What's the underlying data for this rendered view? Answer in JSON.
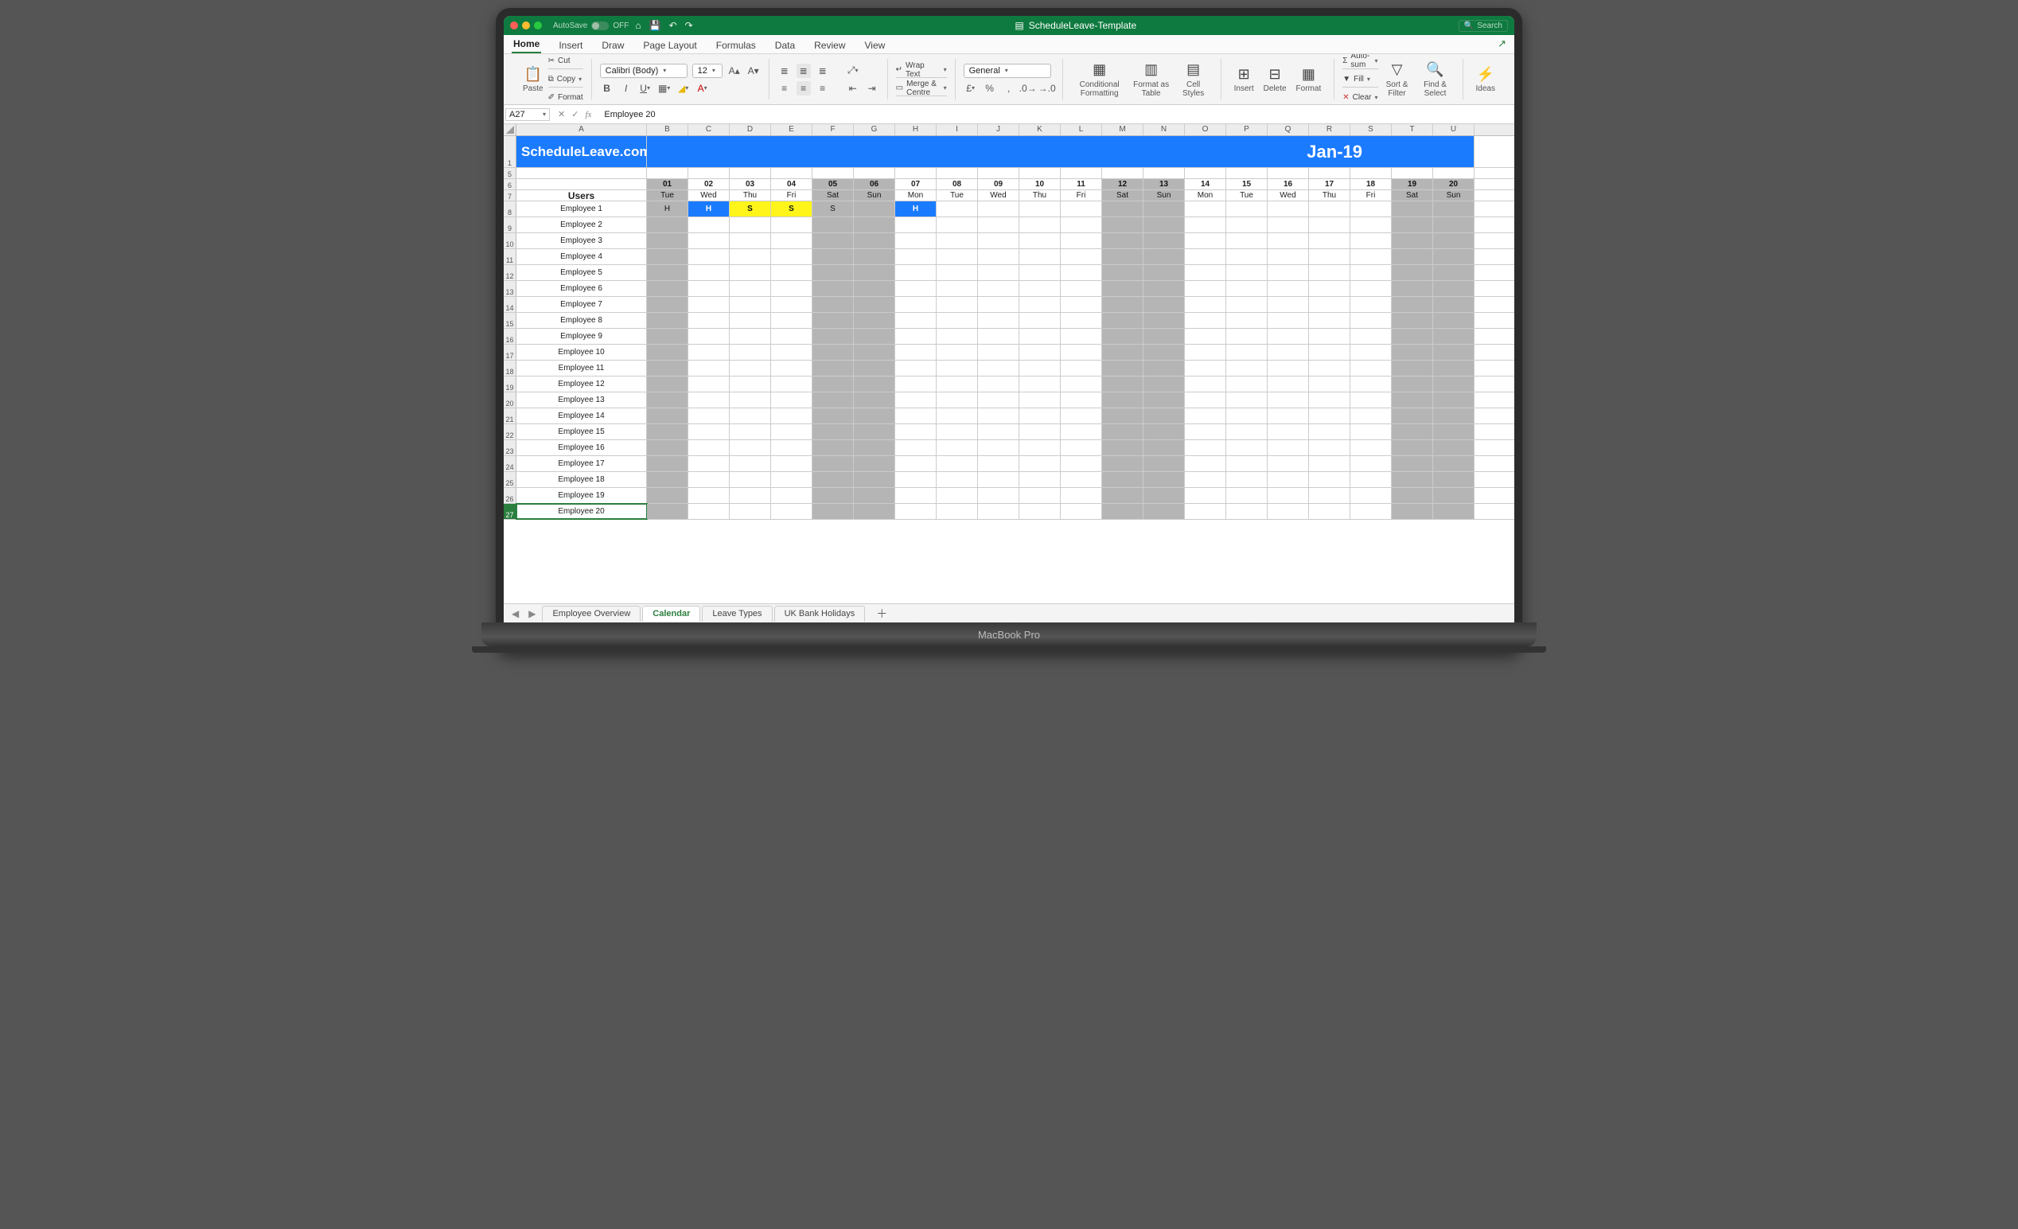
{
  "title": "ScheduleLeave-Template",
  "autosave_label": "AutoSave",
  "autosave_state": "OFF",
  "search_placeholder": "Search",
  "laptop_brand": "MacBook Pro",
  "ribbon_tabs": [
    "Home",
    "Insert",
    "Draw",
    "Page Layout",
    "Formulas",
    "Data",
    "Review",
    "View"
  ],
  "ribbon": {
    "paste": "Paste",
    "cut": "Cut",
    "copy": "Copy",
    "format": "Format",
    "font_name": "Calibri (Body)",
    "font_size": "12",
    "wrap": "Wrap Text",
    "merge": "Merge & Centre",
    "number_format": "General",
    "cond": "Conditional Formatting",
    "fat": "Format as Table",
    "cstyles": "Cell Styles",
    "insert": "Insert",
    "delete": "Delete",
    "rformat": "Format",
    "autosum": "Auto-sum",
    "fill": "Fill",
    "clear": "Clear",
    "sort": "Sort & Filter",
    "find": "Find & Select",
    "ideas": "Ideas"
  },
  "formula_bar": {
    "cell_ref": "A27",
    "value": "Employee 20"
  },
  "columns": [
    "A",
    "B",
    "C",
    "D",
    "E",
    "F",
    "G",
    "H",
    "I",
    "J",
    "K",
    "L",
    "M",
    "N",
    "O",
    "P",
    "Q",
    "R",
    "S",
    "T",
    "U"
  ],
  "banner": {
    "brand": "ScheduleLeave.com",
    "month": "Jan-19"
  },
  "dates": [
    {
      "d": "01",
      "w": "Tue",
      "wk": true
    },
    {
      "d": "02",
      "w": "Wed"
    },
    {
      "d": "03",
      "w": "Thu"
    },
    {
      "d": "04",
      "w": "Fri"
    },
    {
      "d": "05",
      "w": "Sat",
      "wk": true
    },
    {
      "d": "06",
      "w": "Sun",
      "wk": true
    },
    {
      "d": "07",
      "w": "Mon"
    },
    {
      "d": "08",
      "w": "Tue"
    },
    {
      "d": "09",
      "w": "Wed"
    },
    {
      "d": "10",
      "w": "Thu"
    },
    {
      "d": "11",
      "w": "Fri"
    },
    {
      "d": "12",
      "w": "Sat",
      "wk": true
    },
    {
      "d": "13",
      "w": "Sun",
      "wk": true
    },
    {
      "d": "14",
      "w": "Mon"
    },
    {
      "d": "15",
      "w": "Tue"
    },
    {
      "d": "16",
      "w": "Wed"
    },
    {
      "d": "17",
      "w": "Thu"
    },
    {
      "d": "18",
      "w": "Fri"
    },
    {
      "d": "19",
      "w": "Sat",
      "wk": true
    },
    {
      "d": "20",
      "w": "Sun",
      "wk": true
    }
  ],
  "users_header": "Users",
  "employees": [
    {
      "name": "Employee 1",
      "cells": {
        "0": {
          "t": "H",
          "c": "wk"
        },
        "1": {
          "t": "H",
          "c": "bh"
        },
        "2": {
          "t": "S",
          "c": "bs"
        },
        "3": {
          "t": "S",
          "c": "bs"
        },
        "4": {
          "t": "S",
          "c": "wk"
        },
        "6": {
          "t": "H",
          "c": "bh"
        }
      }
    },
    {
      "name": "Employee 2"
    },
    {
      "name": "Employee 3"
    },
    {
      "name": "Employee 4"
    },
    {
      "name": "Employee 5"
    },
    {
      "name": "Employee 6"
    },
    {
      "name": "Employee 7"
    },
    {
      "name": "Employee 8"
    },
    {
      "name": "Employee 9"
    },
    {
      "name": "Employee 10"
    },
    {
      "name": "Employee 11"
    },
    {
      "name": "Employee 12"
    },
    {
      "name": "Employee 13"
    },
    {
      "name": "Employee 14"
    },
    {
      "name": "Employee 15"
    },
    {
      "name": "Employee 16"
    },
    {
      "name": "Employee 17"
    },
    {
      "name": "Employee 18"
    },
    {
      "name": "Employee 19"
    },
    {
      "name": "Employee 20"
    }
  ],
  "sheet_tabs": [
    "Employee Overview",
    "Calendar",
    "Leave Types",
    "UK Bank Holidays"
  ],
  "active_sheet": 1
}
